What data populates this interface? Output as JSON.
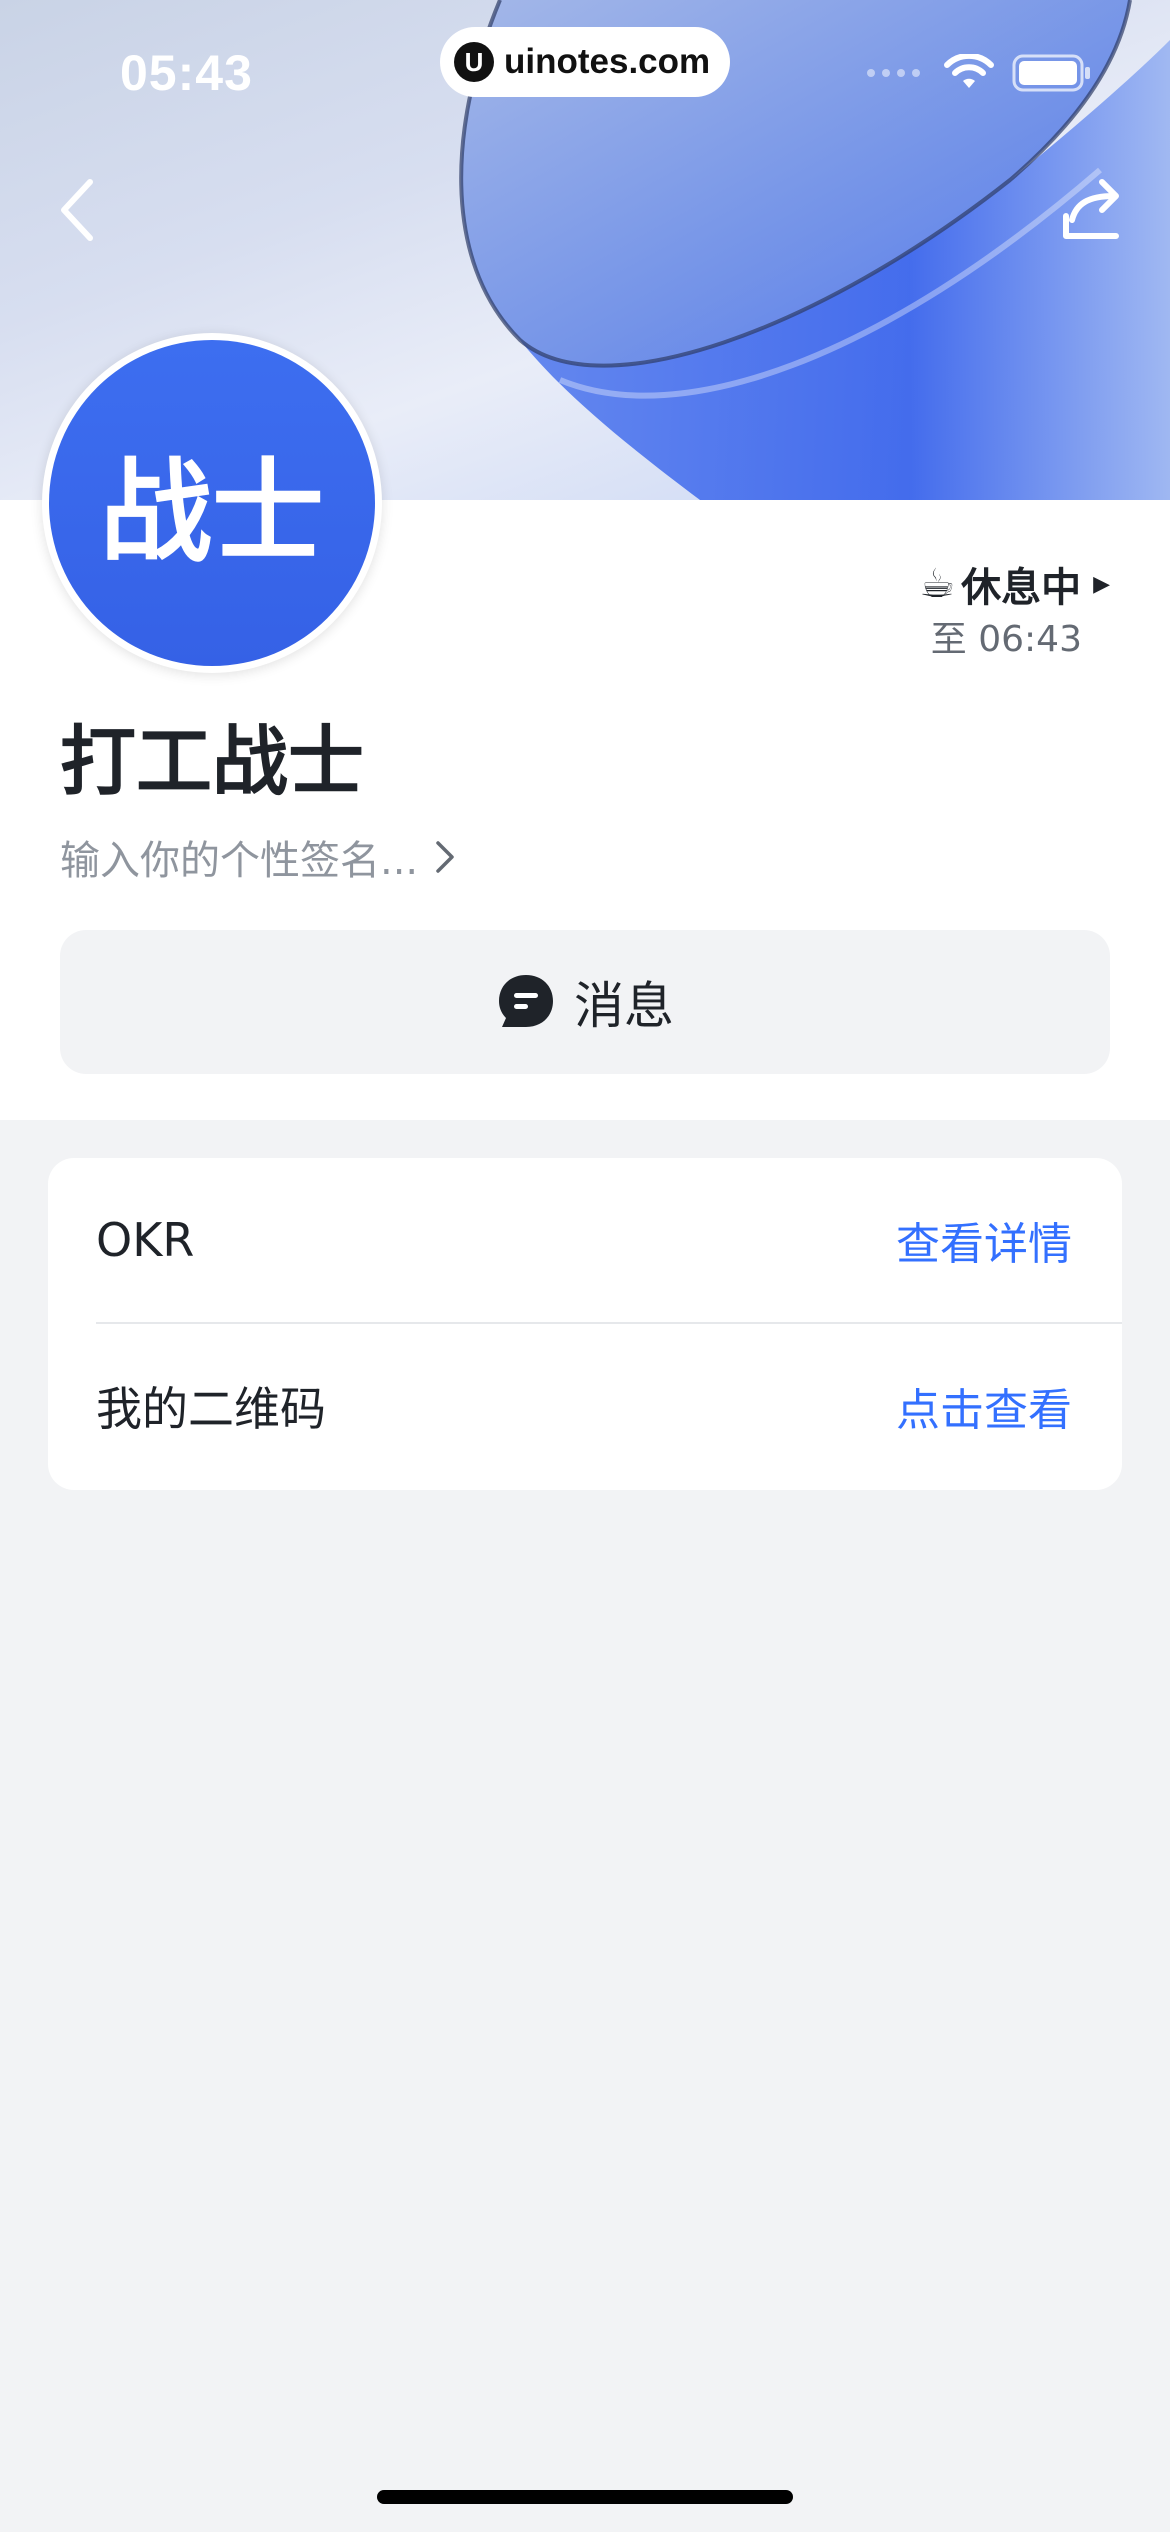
{
  "status_bar": {
    "time": "05:43",
    "url": "uinotes.com",
    "url_logo": "U"
  },
  "nav": {
    "back_icon": "chevron-left-icon",
    "share_icon": "share-icon"
  },
  "profile": {
    "avatar_text": "战士",
    "name": "打工战士",
    "signature_placeholder": "输入你的个性签名...",
    "status_emoji": "☕",
    "status_label": "休息中",
    "status_until": "至 06:43"
  },
  "message_button": {
    "label": "消息",
    "icon": "chat-bubble-icon"
  },
  "list": {
    "items": [
      {
        "title": "OKR",
        "action": "查看详情"
      },
      {
        "title": "我的二维码",
        "action": "点击查看"
      }
    ]
  },
  "colors": {
    "accent": "#3370ff",
    "avatar_bg": "#3561e6",
    "page_bg": "#f2f3f5",
    "text_primary": "#1f2329",
    "text_secondary": "#8f959e"
  }
}
